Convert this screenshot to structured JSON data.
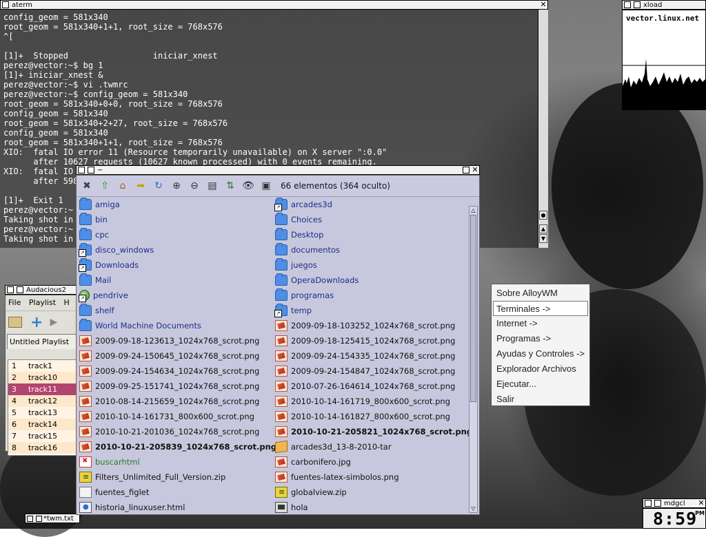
{
  "aterm": {
    "title": "aterm",
    "lines": [
      "config_geom = 581x340",
      "root_geom = 581x340+1+1, root_size = 768x576",
      "^[",
      "",
      "[1]+  Stopped                 iniciar_xnest",
      "perez@vector:~$ bg 1",
      "[1]+ iniciar_xnest &",
      "perez@vector:~$ vi .twmrc",
      "perez@vector:~$ config_geom = 581x340",
      "root_geom = 581x340+0+0, root_size = 768x576",
      "config_geom = 581x340",
      "root_geom = 581x340+2+27, root_size = 768x576",
      "config_geom = 581x340",
      "root_geom = 581x340+1+1, root_size = 768x576",
      "XIO:  fatal IO error 11 (Resource temporarily unavailable) on X server \":0.0\"",
      "      after 10627 requests (10627 known processed) with 0 events remaining.",
      "XIO:  fatal IO",
      "      after 598",
      "",
      "[1]+  Exit 1",
      "perez@vector:~",
      "Taking shot in",
      "perez@vector:~",
      "Taking shot in"
    ]
  },
  "xload": {
    "title": "xload",
    "host": "vector.linux.net"
  },
  "audacious": {
    "title": "Audacious2",
    "menu": [
      "File",
      "Playlist",
      "H"
    ],
    "playlist_tab": "Untitled Playlist",
    "tracks": [
      {
        "n": "1",
        "name": "track1"
      },
      {
        "n": "2",
        "name": "track10"
      },
      {
        "n": "3",
        "name": "track11"
      },
      {
        "n": "4",
        "name": "track12"
      },
      {
        "n": "5",
        "name": "track13"
      },
      {
        "n": "6",
        "name": "track14"
      },
      {
        "n": "7",
        "name": "track15"
      },
      {
        "n": "8",
        "name": "track16"
      }
    ],
    "selected_track_index": 2
  },
  "filemanager": {
    "title": "~",
    "status": "66 elementos (364 oculto)",
    "left": [
      {
        "name": "amiga",
        "kind": "folder"
      },
      {
        "name": "bin",
        "kind": "folder"
      },
      {
        "name": "cpc",
        "kind": "folder"
      },
      {
        "name": "disco_windows",
        "kind": "link"
      },
      {
        "name": "Downloads",
        "kind": "link"
      },
      {
        "name": "Mail",
        "kind": "folder"
      },
      {
        "name": "pendrive",
        "kind": "mount"
      },
      {
        "name": "shelf",
        "kind": "folder"
      },
      {
        "name": "World Machine Documents",
        "kind": "folder"
      },
      {
        "name": "2009-09-18-123613_1024x768_scrot.png",
        "kind": "image"
      },
      {
        "name": "2009-09-24-150645_1024x768_scrot.png",
        "kind": "image"
      },
      {
        "name": "2009-09-24-154634_1024x768_scrot.png",
        "kind": "image"
      },
      {
        "name": "2009-09-25-151741_1024x768_scrot.png",
        "kind": "image"
      },
      {
        "name": "2010-08-14-215659_1024x768_scrot.png",
        "kind": "image"
      },
      {
        "name": "2010-10-14-161731_800x600_scrot.png",
        "kind": "image"
      },
      {
        "name": "2010-10-21-201036_1024x768_scrot.png",
        "kind": "image"
      },
      {
        "name": "2010-10-21-205839_1024x768_scrot.png",
        "kind": "image",
        "bold": true
      },
      {
        "name": "buscarhtml",
        "kind": "exec"
      },
      {
        "name": "Filters_Unlimited_Full_Version.zip",
        "kind": "zip"
      },
      {
        "name": "fuentes_figlet",
        "kind": "blank"
      },
      {
        "name": "historia_linuxuser.html",
        "kind": "html"
      }
    ],
    "right": [
      {
        "name": "arcades3d",
        "kind": "link"
      },
      {
        "name": "Choices",
        "kind": "folder"
      },
      {
        "name": "Desktop",
        "kind": "folder"
      },
      {
        "name": "documentos",
        "kind": "folder"
      },
      {
        "name": "juegos",
        "kind": "folder"
      },
      {
        "name": "OperaDownloads",
        "kind": "folder"
      },
      {
        "name": "programas",
        "kind": "folder"
      },
      {
        "name": "temp",
        "kind": "link"
      },
      {
        "name": "2009-09-18-103252_1024x768_scrot.png",
        "kind": "image"
      },
      {
        "name": "2009-09-18-125415_1024x768_scrot.png",
        "kind": "image"
      },
      {
        "name": "2009-09-24-154335_1024x768_scrot.png",
        "kind": "image"
      },
      {
        "name": "2009-09-24-154847_1024x768_scrot.png",
        "kind": "image"
      },
      {
        "name": "2010-07-26-164614_1024x768_scrot.png",
        "kind": "image"
      },
      {
        "name": "2010-10-14-161719_800x600_scrot.png",
        "kind": "image"
      },
      {
        "name": "2010-10-14-161827_800x600_scrot.png",
        "kind": "image"
      },
      {
        "name": "2010-10-21-205821_1024x768_scrot.png",
        "kind": "image",
        "bold": true
      },
      {
        "name": "arcades3d_13-8-2010-tar",
        "kind": "tar"
      },
      {
        "name": "carbonifero.jpg",
        "kind": "image"
      },
      {
        "name": "fuentes-latex-simbolos.png",
        "kind": "image"
      },
      {
        "name": "globalview.zip",
        "kind": "zip"
      },
      {
        "name": "hola",
        "kind": "exe"
      }
    ]
  },
  "root_menu": {
    "items": [
      "Sobre AlloyWM",
      "Terminales ->",
      "Internet ->",
      "Programas ->",
      "Ayudas y Controles ->",
      "Explorador Archivos",
      "Ejecutar...",
      "Salir"
    ],
    "selected_index": 1
  },
  "clock": {
    "title": "mdgcl",
    "time": "8:59",
    "ampm": "PM"
  },
  "twm_icon": {
    "label": "*twm.txt"
  },
  "colors": {
    "folder": "#4f8ee6",
    "track_selected": "#b2456f",
    "fm_background": "#c7c8dd"
  }
}
